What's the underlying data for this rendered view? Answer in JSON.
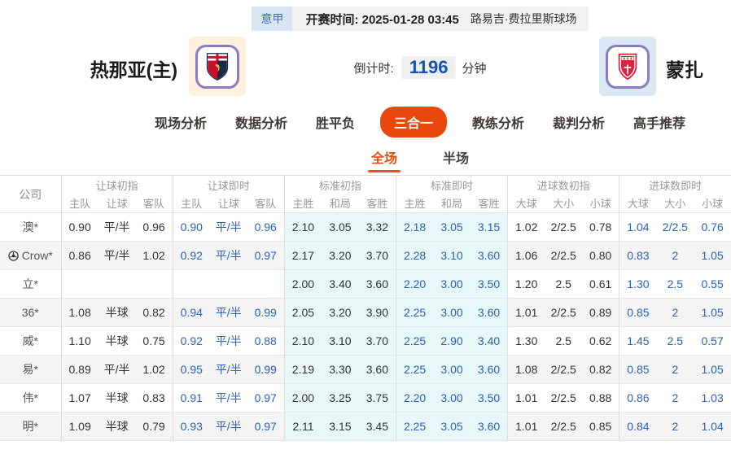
{
  "header": {
    "league_badge": "意甲",
    "kickoff_label": "开赛时间:",
    "kickoff_time": "2025-01-28 03:45",
    "venue": "路易吉·费拉里斯球场"
  },
  "match": {
    "home_team": "热那亚(主)",
    "away_team": "蒙扎",
    "countdown_label": "倒计时:",
    "countdown_value": "1196",
    "countdown_unit": "分钟"
  },
  "nav_tabs": [
    {
      "label": "现场分析",
      "active": false
    },
    {
      "label": "数据分析",
      "active": false
    },
    {
      "label": "胜平负",
      "active": false
    },
    {
      "label": "三合一",
      "active": true
    },
    {
      "label": "教练分析",
      "active": false
    },
    {
      "label": "裁判分析",
      "active": false
    },
    {
      "label": "高手推荐",
      "active": false
    }
  ],
  "sub_tabs": [
    {
      "label": "全场",
      "active": true
    },
    {
      "label": "半场",
      "active": false
    }
  ],
  "odds_table": {
    "company_header": "公司",
    "groups": [
      {
        "label": "让球初指",
        "columns": [
          "主队",
          "让球",
          "客队"
        ],
        "live": false,
        "highlight": false
      },
      {
        "label": "让球即时",
        "columns": [
          "主队",
          "让球",
          "客队"
        ],
        "live": true,
        "highlight": false
      },
      {
        "label": "标准初指",
        "columns": [
          "主胜",
          "和局",
          "客胜"
        ],
        "live": false,
        "highlight": true
      },
      {
        "label": "标准即时",
        "columns": [
          "主胜",
          "和局",
          "客胜"
        ],
        "live": true,
        "highlight": true
      },
      {
        "label": "进球数初指",
        "columns": [
          "大球",
          "大小",
          "小球"
        ],
        "live": false,
        "highlight": false
      },
      {
        "label": "进球数即时",
        "columns": [
          "大球",
          "大小",
          "小球"
        ],
        "live": true,
        "highlight": false
      }
    ],
    "rows": [
      {
        "company": "澳*",
        "has_icon": false,
        "values": [
          [
            "0.90",
            "平/半",
            "0.96"
          ],
          [
            "0.90",
            "平/半",
            "0.96"
          ],
          [
            "2.10",
            "3.05",
            "3.32"
          ],
          [
            "2.18",
            "3.05",
            "3.15"
          ],
          [
            "1.02",
            "2/2.5",
            "0.78"
          ],
          [
            "1.04",
            "2/2.5",
            "0.76"
          ]
        ]
      },
      {
        "company": "Crow*",
        "has_icon": true,
        "values": [
          [
            "0.86",
            "平/半",
            "1.02"
          ],
          [
            "0.92",
            "平/半",
            "0.97"
          ],
          [
            "2.17",
            "3.20",
            "3.70"
          ],
          [
            "2.28",
            "3.10",
            "3.60"
          ],
          [
            "1.06",
            "2/2.5",
            "0.80"
          ],
          [
            "0.83",
            "2",
            "1.05"
          ]
        ]
      },
      {
        "company": "立*",
        "has_icon": false,
        "values": [
          [
            "",
            "",
            ""
          ],
          [
            "",
            "",
            ""
          ],
          [
            "2.00",
            "3.40",
            "3.60"
          ],
          [
            "2.20",
            "3.00",
            "3.50"
          ],
          [
            "1.20",
            "2.5",
            "0.61"
          ],
          [
            "1.30",
            "2.5",
            "0.55"
          ]
        ]
      },
      {
        "company": "36*",
        "has_icon": false,
        "values": [
          [
            "1.08",
            "半球",
            "0.82"
          ],
          [
            "0.94",
            "平/半",
            "0.99"
          ],
          [
            "2.05",
            "3.20",
            "3.90"
          ],
          [
            "2.25",
            "3.00",
            "3.60"
          ],
          [
            "1.01",
            "2/2.5",
            "0.89"
          ],
          [
            "0.85",
            "2",
            "1.05"
          ]
        ]
      },
      {
        "company": "威*",
        "has_icon": false,
        "values": [
          [
            "1.10",
            "半球",
            "0.75"
          ],
          [
            "0.92",
            "平/半",
            "0.88"
          ],
          [
            "2.10",
            "3.10",
            "3.70"
          ],
          [
            "2.25",
            "2.90",
            "3.40"
          ],
          [
            "1.30",
            "2.5",
            "0.62"
          ],
          [
            "1.45",
            "2.5",
            "0.57"
          ]
        ]
      },
      {
        "company": "易*",
        "has_icon": false,
        "values": [
          [
            "0.89",
            "平/半",
            "1.02"
          ],
          [
            "0.95",
            "平/半",
            "0.99"
          ],
          [
            "2.19",
            "3.30",
            "3.60"
          ],
          [
            "2.25",
            "3.00",
            "3.60"
          ],
          [
            "1.08",
            "2/2.5",
            "0.82"
          ],
          [
            "0.85",
            "2",
            "1.05"
          ]
        ]
      },
      {
        "company": "伟*",
        "has_icon": false,
        "values": [
          [
            "1.07",
            "半球",
            "0.83"
          ],
          [
            "0.91",
            "平/半",
            "0.97"
          ],
          [
            "2.00",
            "3.25",
            "3.75"
          ],
          [
            "2.20",
            "3.00",
            "3.50"
          ],
          [
            "1.01",
            "2/2.5",
            "0.88"
          ],
          [
            "0.86",
            "2",
            "1.03"
          ]
        ]
      },
      {
        "company": "明*",
        "has_icon": false,
        "values": [
          [
            "1.09",
            "半球",
            "0.79"
          ],
          [
            "0.93",
            "平/半",
            "0.97"
          ],
          [
            "2.11",
            "3.15",
            "3.45"
          ],
          [
            "2.25",
            "3.05",
            "3.60"
          ],
          [
            "1.01",
            "2/2.5",
            "0.85"
          ],
          [
            "0.84",
            "2",
            "1.04"
          ]
        ]
      }
    ]
  },
  "colors": {
    "accent_orange": "#e8480c",
    "subtab_orange": "#e14e14",
    "live_blue": "#2a62b8",
    "countdown_blue": "#1452af",
    "badge_blue_bg": "#d8e5f3",
    "badge_blue_text": "#3f6fc1",
    "highlight_cyan": "#e8f7f7",
    "row_stripe_gray": "#f4f4f4",
    "home_logo_bg": "#fdf1dd",
    "away_logo_bg": "#dae8f6",
    "logo_border_purple": "#8a7cbe"
  }
}
